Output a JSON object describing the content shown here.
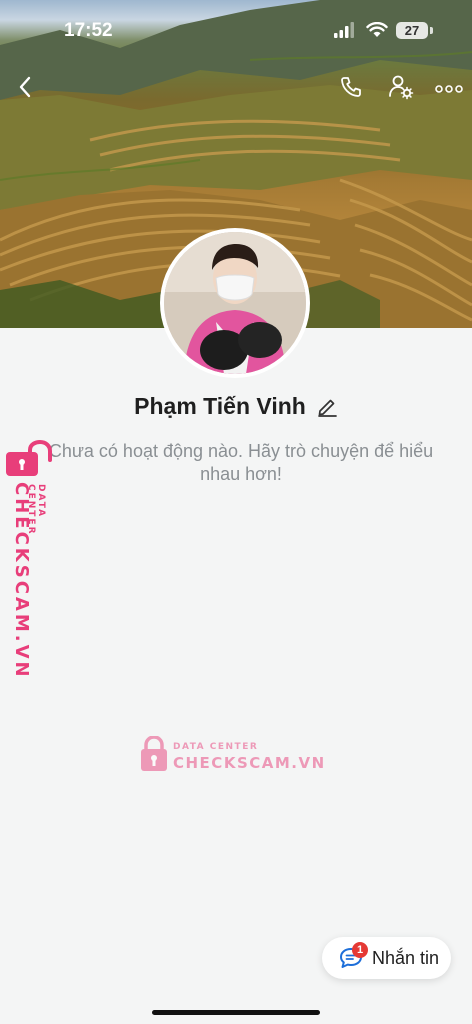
{
  "status_bar": {
    "time": "17:52",
    "battery": "27"
  },
  "profile": {
    "name": "Phạm Tiến Vinh",
    "empty_message": "Chưa có hoạt động nào. Hãy trò chuyện để hiểu nhau hơn!"
  },
  "watermark": {
    "brand": "CHECKSCAM.VN",
    "subtitle": "DATA CENTER"
  },
  "message_button": {
    "label": "Nhắn tin",
    "badge": "1"
  },
  "icons": {
    "back": "chevron-left-icon",
    "call": "phone-icon",
    "profile_settings": "user-gear-icon",
    "more": "ellipsis-icon",
    "edit": "pencil-icon",
    "chat": "chat-bubble-icon"
  }
}
